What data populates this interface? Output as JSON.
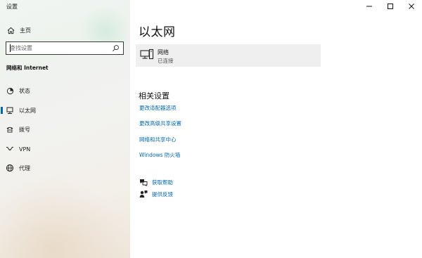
{
  "window": {
    "title": "设置",
    "controls": {
      "minimize": "—",
      "maximize": "☐",
      "close": "✕"
    }
  },
  "sidebar": {
    "home_label": "主页",
    "search": {
      "placeholder": "查找设置",
      "value": ""
    },
    "section_label": "网络和 Internet",
    "items": [
      {
        "label": "状态",
        "icon": "status-icon",
        "active": false
      },
      {
        "label": "以太网",
        "icon": "ethernet-icon",
        "active": true
      },
      {
        "label": "拨号",
        "icon": "dialup-icon",
        "active": false
      },
      {
        "label": "VPN",
        "icon": "vpn-icon",
        "active": false
      },
      {
        "label": "代理",
        "icon": "globe-icon",
        "active": false
      }
    ]
  },
  "main": {
    "title": "以太网",
    "network": {
      "name": "网络",
      "status": "已连接",
      "icon": "network-pc-icon"
    },
    "related_title": "相关设置",
    "links": [
      "更改适配器选项",
      "更改高级共享设置",
      "网络和共享中心",
      "Windows 防火墙"
    ],
    "help": [
      {
        "label": "获取帮助",
        "icon": "help-chat-icon"
      },
      {
        "label": "提供反馈",
        "icon": "feedback-icon"
      }
    ]
  },
  "colors": {
    "accent": "#0063b1",
    "link": "#0066b4",
    "card_bg": "#efefef"
  }
}
